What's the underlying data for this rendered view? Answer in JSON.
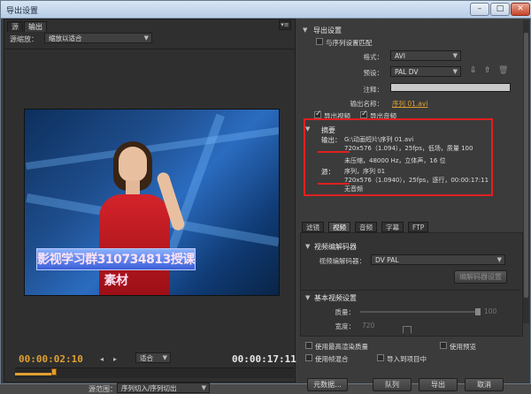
{
  "window": {
    "title": "导出设置"
  },
  "left": {
    "tabs": [
      "源",
      "输出"
    ],
    "scale_label": "源缩放：",
    "scale_value": "缩放以适合",
    "watermark": "影视学习群310734813授课素材",
    "timecode_current": "00:00:02:10",
    "timecode_end": "00:00:17:11",
    "fit_value": "适合",
    "source_range_label": "源范围：",
    "source_range_value": "序列切入/序列切出",
    "progress": 0.14
  },
  "right": {
    "export_settings_title": "导出设置",
    "match_seq_label": "与序列设置匹配",
    "format_label": "格式：",
    "format_value": "AVI",
    "preset_label": "预设：",
    "preset_value": "PAL DV",
    "comment_label": "注释：",
    "output_name_label": "输出名称：",
    "output_name_value": "序列 01.avi",
    "export_video_label": "导出视频",
    "export_audio_label": "导出音频",
    "summary_title": "摘要",
    "output_label": "输出：",
    "output_path": "G:\\动画短片\\序列 01.avi",
    "output_line2": "720x576（1.094），25fps，低场，质量 100",
    "output_line3": "未压缩，48000 Hz，立体声，16 位",
    "source_label": "源：",
    "source_name": "序列，序列 01",
    "source_line2": "720x576（1.0940），25fps，逐行，00:00:17:11",
    "source_line3": "无音频",
    "tabs": [
      "滤镜",
      "视频",
      "音频",
      "字幕",
      "FTP"
    ],
    "video_codec_section": "视频编解码器",
    "video_codec_label": "视频编解码器：",
    "video_codec_value": "DV PAL",
    "codec_settings_button": "编解码器设置",
    "basic_video_section": "基本视频设置",
    "quality_label": "质量：",
    "quality_value": "100",
    "width_label": "宽度：",
    "width_value": "720",
    "max_render_label": "使用最高渲染质量",
    "use_preview_label": "使用预览",
    "frame_blend_label": "使用帧混合",
    "import_project_label": "导入到项目中",
    "metadata_button": "元数据...",
    "queue_button": "队列",
    "export_button": "导出",
    "cancel_button": "取消"
  },
  "colors": {
    "accent": "#e0a030",
    "highlight": "#e02020"
  }
}
